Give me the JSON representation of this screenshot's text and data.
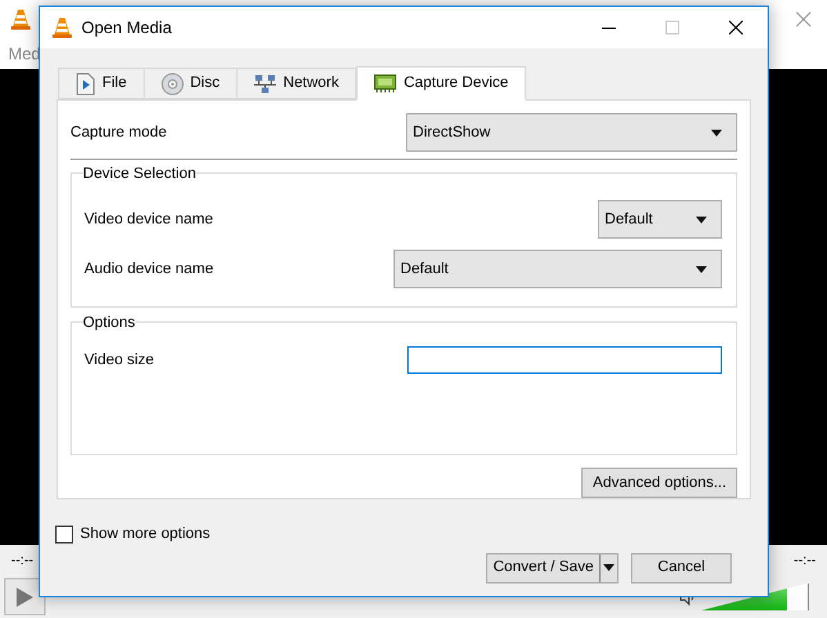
{
  "player": {
    "menu": "Med",
    "elapsed": "--:--",
    "remaining": "--:--",
    "volume": {
      "level": 0.8
    }
  },
  "dialog": {
    "title": "Open Media",
    "tabs": [
      {
        "label": "File",
        "selected": false
      },
      {
        "label": "Disc",
        "selected": false
      },
      {
        "label": "Network",
        "selected": false
      },
      {
        "label": "Capture Device",
        "selected": true
      }
    ],
    "capture_mode": {
      "label": "Capture mode",
      "value": "DirectShow"
    },
    "device_selection": {
      "title": "Device Selection",
      "fields": [
        {
          "label": "Video device name",
          "value": "Default"
        },
        {
          "label": "Audio device name",
          "value": "Default"
        }
      ]
    },
    "options": {
      "title": "Options",
      "fields": [
        {
          "label": "Video size",
          "focused": true
        }
      ]
    },
    "advanced_button": "Advanced options...",
    "show_more": {
      "label": "Show more options",
      "checked": false
    },
    "buttons": {
      "primary": "Convert / Save",
      "cancel": "Cancel"
    }
  }
}
